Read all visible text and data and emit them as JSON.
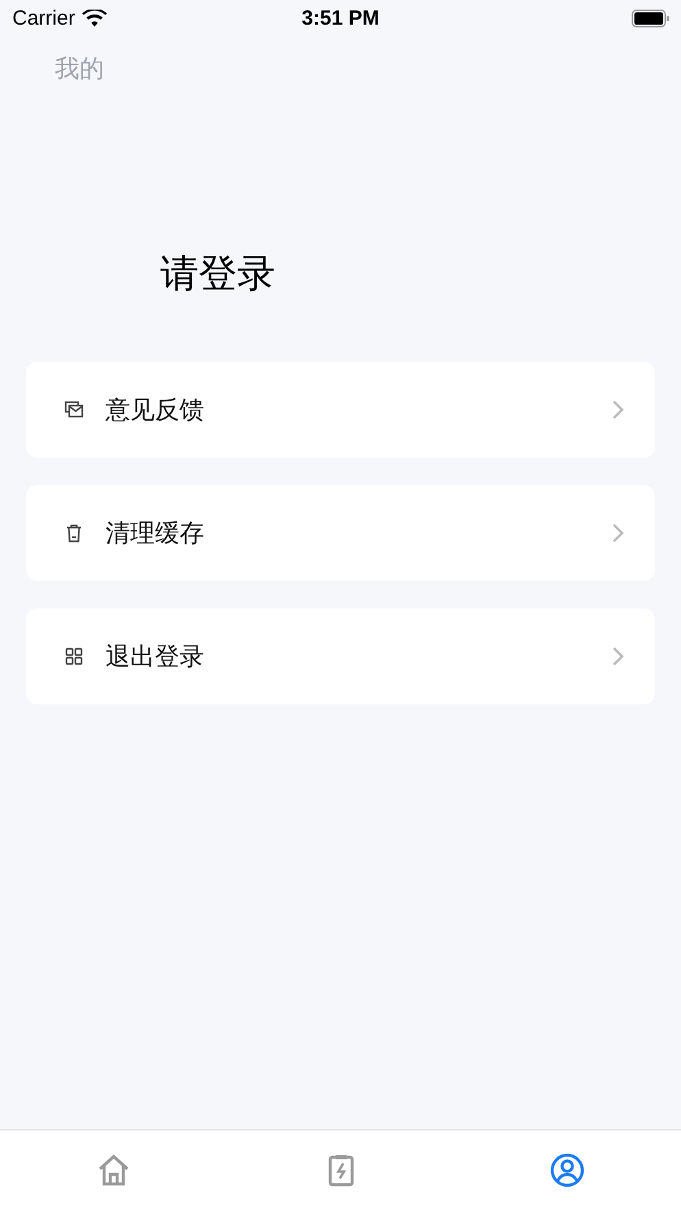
{
  "status_bar": {
    "carrier": "Carrier",
    "time": "3:51 PM"
  },
  "header": {
    "title": "我的"
  },
  "login_prompt": "请登录",
  "menu": [
    {
      "kind": "mail",
      "label": "意见反馈"
    },
    {
      "kind": "trash",
      "label": "清理缓存"
    },
    {
      "kind": "grid",
      "label": "退出登录"
    }
  ],
  "tab_bar": [
    {
      "kind": "home",
      "selected": false
    },
    {
      "kind": "clipboard",
      "selected": false
    },
    {
      "kind": "user",
      "selected": true
    }
  ]
}
